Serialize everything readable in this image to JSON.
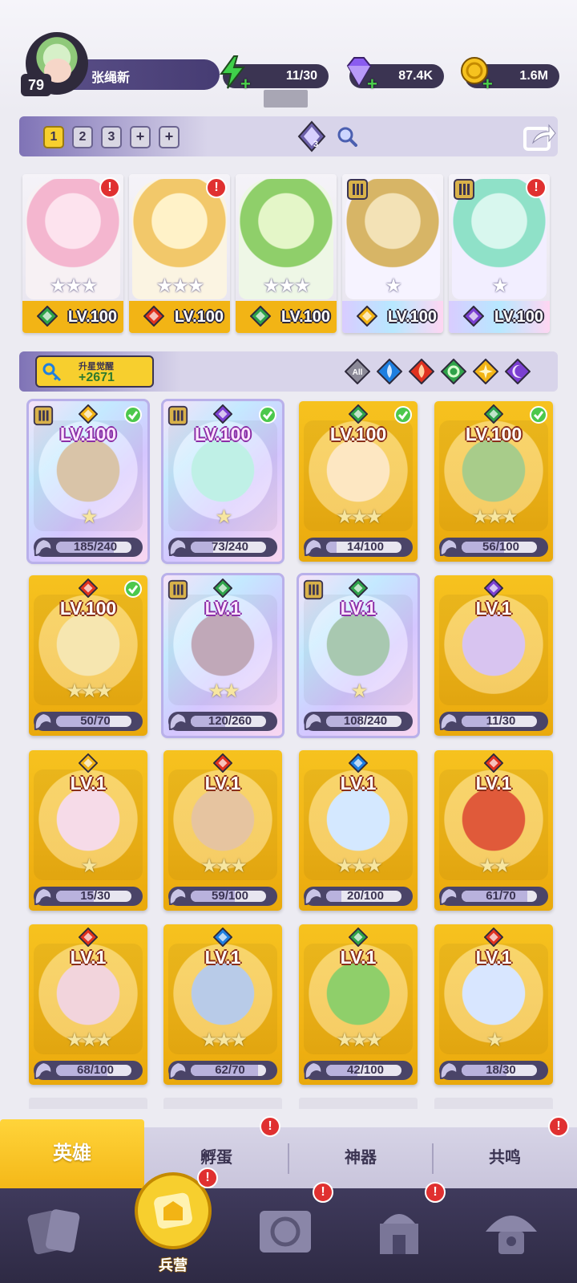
{
  "player": {
    "level": "79",
    "name": "张绳新"
  },
  "resources": [
    {
      "id": "energy",
      "value": "11/30",
      "icon": "lightning-icon",
      "color": "#3fd04a"
    },
    {
      "id": "gems",
      "value": "87.4K",
      "icon": "diamond-icon",
      "color": "#8a5cf0"
    },
    {
      "id": "gold",
      "value": "1.6M",
      "icon": "coin-icon",
      "color": "#f6c21f"
    }
  ],
  "team_tabs": {
    "items": [
      "1",
      "2",
      "3",
      "+",
      "+"
    ],
    "active": "1"
  },
  "team_gem_count": "3",
  "team": [
    {
      "level": "LV.100",
      "stars": "★★★",
      "element": "nature",
      "alert": "!"
    },
    {
      "level": "LV.100",
      "stars": "★★★",
      "element": "fire",
      "alert": "!"
    },
    {
      "level": "LV.100",
      "stars": "★★★",
      "element": "nature"
    },
    {
      "level": "LV.100",
      "stars": "★",
      "element": "light",
      "rank": "III"
    },
    {
      "level": "LV.100",
      "stars": "★",
      "element": "dark",
      "rank": "II",
      "alert": "!"
    }
  ],
  "awaken": {
    "label": "升星觉醒",
    "value": "+2671"
  },
  "filters": [
    "All",
    "water",
    "fire",
    "nature",
    "light",
    "dark"
  ],
  "heroes": [
    {
      "level": "LV.100",
      "shards": "185/240",
      "progress": 0.77,
      "stars": "★",
      "element": "light",
      "rank": "III",
      "check": true,
      "style": "rainbow"
    },
    {
      "level": "LV.100",
      "shards": "73/240",
      "progress": 0.3,
      "stars": "★",
      "element": "dark",
      "rank": "II",
      "check": true,
      "style": "rainbow"
    },
    {
      "level": "LV.100",
      "shards": "14/100",
      "progress": 0.14,
      "stars": "★★★",
      "element": "nature",
      "check": true,
      "style": "gold"
    },
    {
      "level": "LV.100",
      "shards": "56/100",
      "progress": 0.56,
      "stars": "★★★",
      "element": "nature",
      "check": true,
      "style": "gold"
    },
    {
      "level": "LV.100",
      "shards": "50/70",
      "progress": 0.71,
      "stars": "★★★",
      "element": "fire",
      "check": true,
      "style": "gold"
    },
    {
      "level": "LV.1",
      "shards": "120/260",
      "progress": 0.46,
      "stars": "★★",
      "element": "nature",
      "rank": "III",
      "style": "rainbow"
    },
    {
      "level": "LV.1",
      "shards": "108/240",
      "progress": 0.45,
      "stars": "★",
      "element": "nature",
      "rank": "II",
      "style": "rainbow"
    },
    {
      "level": "LV.1",
      "shards": "11/30",
      "progress": 0.37,
      "stars": "",
      "element": "dark",
      "style": "gold"
    },
    {
      "level": "LV.1",
      "shards": "15/30",
      "progress": 0.5,
      "stars": "★",
      "element": "light",
      "style": "gold"
    },
    {
      "level": "LV.1",
      "shards": "59/100",
      "progress": 0.59,
      "stars": "★★★",
      "element": "fire",
      "style": "gold"
    },
    {
      "level": "LV.1",
      "shards": "20/100",
      "progress": 0.2,
      "stars": "★★★",
      "element": "water",
      "style": "gold"
    },
    {
      "level": "LV.1",
      "shards": "61/70",
      "progress": 0.87,
      "stars": "★★",
      "element": "fire",
      "style": "gold"
    },
    {
      "level": "LV.1",
      "shards": "68/100",
      "progress": 0.68,
      "stars": "★★★",
      "element": "fire",
      "style": "gold"
    },
    {
      "level": "LV.1",
      "shards": "62/70",
      "progress": 0.89,
      "stars": "★★★",
      "element": "water",
      "style": "gold"
    },
    {
      "level": "LV.1",
      "shards": "42/100",
      "progress": 0.42,
      "stars": "★★★",
      "element": "nature",
      "style": "gold"
    },
    {
      "level": "LV.1",
      "shards": "18/30",
      "progress": 0.6,
      "stars": "★",
      "element": "fire",
      "style": "gold"
    }
  ],
  "sub_tabs": [
    {
      "label": "英雄",
      "active": true
    },
    {
      "label": "孵蛋",
      "alert": "!"
    },
    {
      "label": "神器"
    },
    {
      "label": "共鸣",
      "alert": "!"
    }
  ],
  "nav": [
    {
      "icon": "cards-icon"
    },
    {
      "icon": "barracks-icon",
      "label": "兵营",
      "active": true,
      "alert": "!"
    },
    {
      "icon": "map-book-icon",
      "alert": "!"
    },
    {
      "icon": "temple-icon",
      "alert": "!"
    },
    {
      "icon": "mushroom-house-icon"
    }
  ],
  "colors": {
    "fire": "#e0321f",
    "water": "#1e7fe0",
    "nature": "#2fa34a",
    "light": "#f2b415",
    "dark": "#7b3fd1",
    "accent": "#f7cf2e",
    "panel": "#3b3452"
  }
}
